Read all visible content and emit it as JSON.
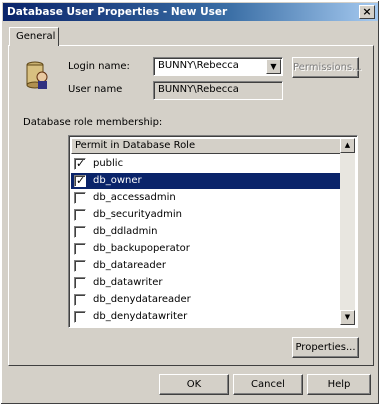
{
  "window": {
    "title": "Database User Properties - New User",
    "close_glyph": "×"
  },
  "tabs": [
    {
      "label": "General"
    }
  ],
  "fields": {
    "login_label": "Login name:",
    "login_value": "BUNNY\\Rebecca",
    "user_label": "User name",
    "user_value": "BUNNY\\Rebecca"
  },
  "buttons": {
    "permissions": "Permissions...",
    "properties": "Properties...",
    "ok": "OK",
    "cancel": "Cancel",
    "help": "Help"
  },
  "roles_label": "Database role membership:",
  "roles_header": "Permit in Database Role",
  "roles": [
    {
      "label": "public",
      "checked": true,
      "selected": false
    },
    {
      "label": "db_owner",
      "checked": true,
      "selected": true
    },
    {
      "label": "db_accessadmin",
      "checked": false,
      "selected": false
    },
    {
      "label": "db_securityadmin",
      "checked": false,
      "selected": false
    },
    {
      "label": "db_ddladmin",
      "checked": false,
      "selected": false
    },
    {
      "label": "db_backupoperator",
      "checked": false,
      "selected": false
    },
    {
      "label": "db_datareader",
      "checked": false,
      "selected": false
    },
    {
      "label": "db_datawriter",
      "checked": false,
      "selected": false
    },
    {
      "label": "db_denydatareader",
      "checked": false,
      "selected": false
    },
    {
      "label": "db_denydatawriter",
      "checked": false,
      "selected": false
    }
  ],
  "icons": {
    "combo_arrow": "▼",
    "scroll_up": "▲",
    "scroll_down": "▼",
    "check": "✓",
    "database": "database-user-icon"
  },
  "colors": {
    "selection": "#0a246a",
    "titlebar": "#0a246a"
  }
}
